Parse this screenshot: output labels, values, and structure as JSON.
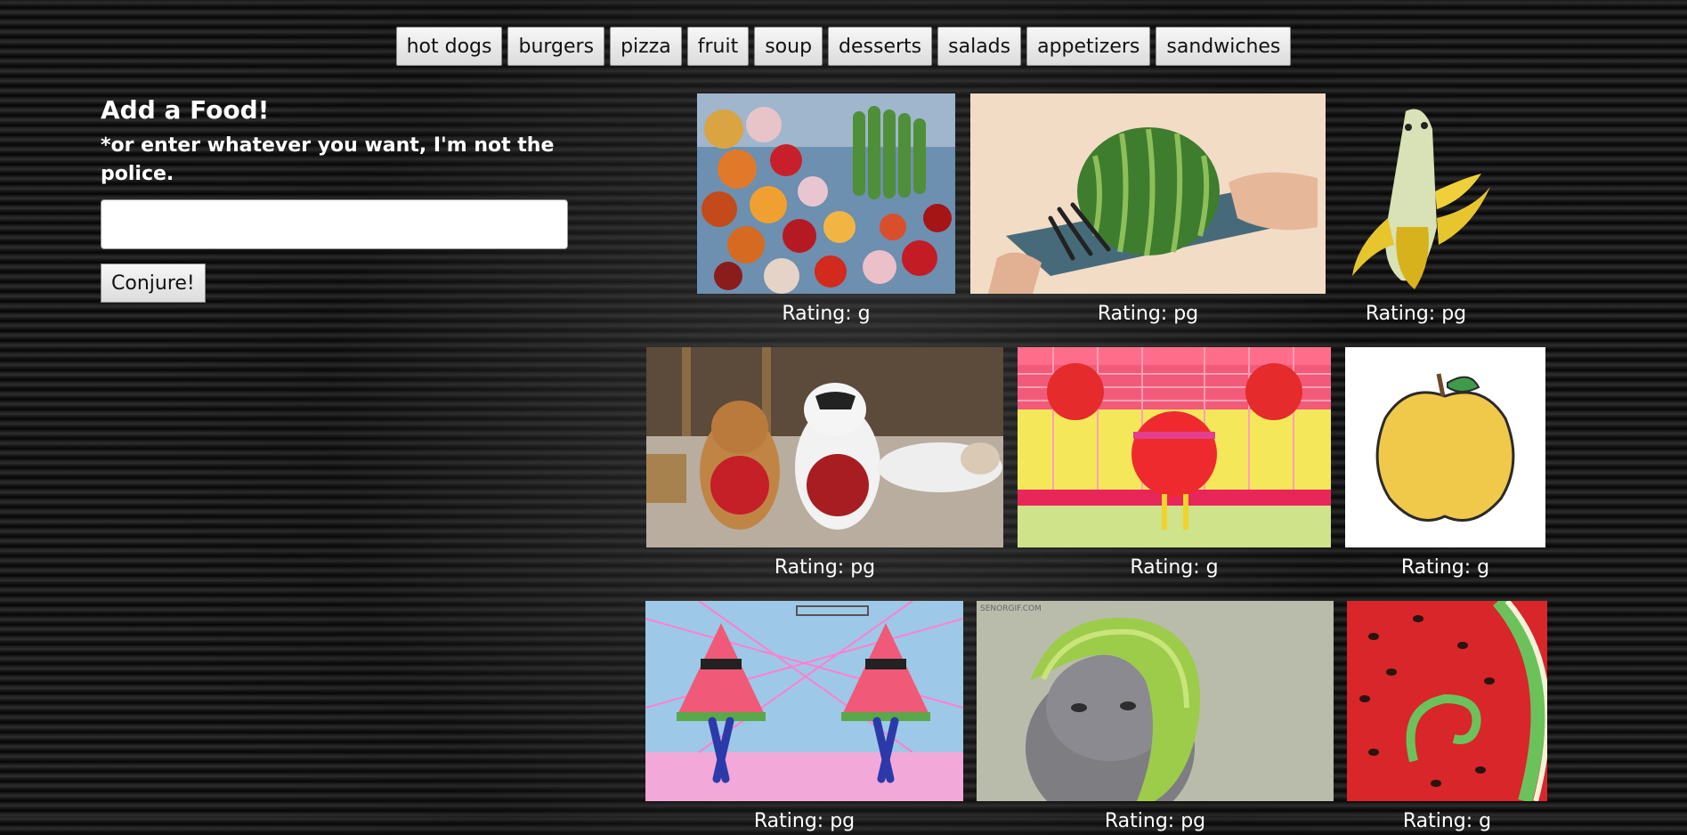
{
  "nav": {
    "items": [
      "hot dogs",
      "burgers",
      "pizza",
      "fruit",
      "soup",
      "desserts",
      "salads",
      "appetizers",
      "sandwiches"
    ]
  },
  "form": {
    "title": "Add a Food!",
    "note": "*or enter whatever you want, I'm not the police.",
    "input_value": "",
    "button_label": "Conjure!"
  },
  "results": {
    "cards": [
      {
        "rating": "Rating: g",
        "subject": "hanging fruit and bananas"
      },
      {
        "rating": "Rating: pg",
        "subject": "watermelon on tray"
      },
      {
        "rating": "Rating: pg",
        "subject": "peeled banana character"
      },
      {
        "rating": "Rating: pg",
        "subject": "cats with apples"
      },
      {
        "rating": "Rating: g",
        "subject": "dancing apples"
      },
      {
        "rating": "Rating: g",
        "subject": "drawn yellow apple"
      },
      {
        "rating": "Rating: pg",
        "subject": "dancing watermelon slices"
      },
      {
        "rating": "Rating: pg",
        "subject": "cat wearing lime helmet"
      },
      {
        "rating": "Rating: g",
        "subject": "watermelon close-up"
      }
    ]
  }
}
